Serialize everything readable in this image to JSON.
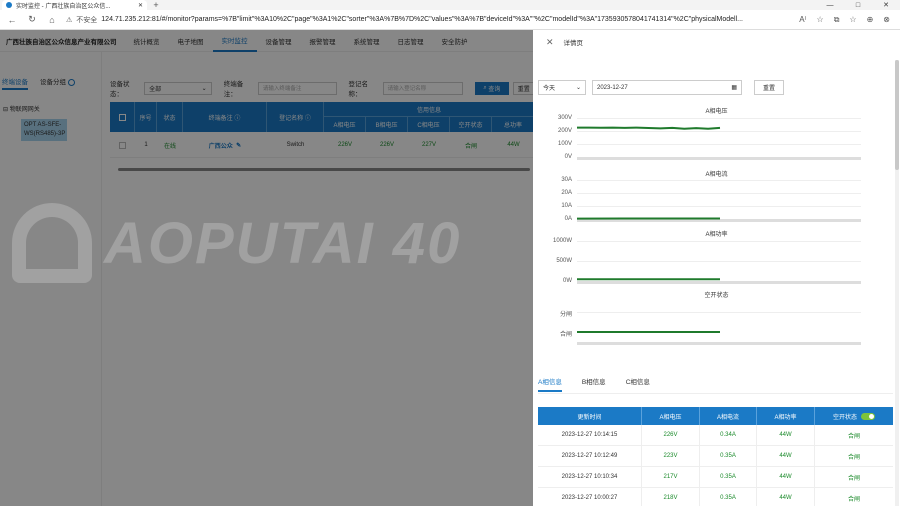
{
  "browser": {
    "tab_title": "实时监控 - 广西壮族自治区公众信...",
    "new_tab": "+",
    "window_controls": [
      "—",
      "□",
      "✕"
    ],
    "insecure_label": "不安全",
    "url": "124.71.235.212:81/#/monitor?params=%7B\"limit\"%3A10%2C\"page\"%3A1%2C\"sorter\"%3A%7B%7D%2C\"values\"%3A%7B\"deviceId\"%3A\"\"%2C\"modelId\"%3A\"1735930578041741314\"%2C\"physicalModell...",
    "tools": [
      "A⁾",
      "☆",
      "⧉",
      "☆",
      "⊕",
      "⊗"
    ]
  },
  "app": {
    "brand": "广西壮族自治区公众信息产业有限公司",
    "nav": [
      "统计概览",
      "电子地图",
      "实时监控",
      "设备管理",
      "报警管理",
      "系统管理",
      "日志管理",
      "安全防护"
    ],
    "nav_active": "实时监控"
  },
  "left_panel": {
    "tabs": [
      "终端设备",
      "设备分组"
    ],
    "tree_root": "物联网网关",
    "tree_child": "OPT AS-SFE-WS(RS485)-3P"
  },
  "filters": {
    "status_label": "设备状态：",
    "status_value": "全部",
    "remark_label": "终端备注：",
    "remark_placeholder": "请输入终端备注",
    "reg_label": "登记名称：",
    "reg_placeholder": "请输入登记名称",
    "query": "查询",
    "reset": "重置"
  },
  "table": {
    "headers": {
      "seq": "序号",
      "status": "状态",
      "remark": "终端备注",
      "reg": "登记名称",
      "group": "信用信息"
    },
    "sub_headers": [
      "A相电压",
      "B相电压",
      "C相电压",
      "空开状态",
      "总功率"
    ],
    "rows": [
      {
        "seq": "1",
        "status": "在线",
        "remark": "广西公众",
        "reg": "Switch",
        "a": "226V",
        "b": "226V",
        "c": "227V",
        "switch": "合闸",
        "power": "44W"
      }
    ]
  },
  "watermark": "AOPUTAI 40",
  "drawer": {
    "title": "详情页",
    "period": "今天",
    "date": "2023-12-27",
    "reset": "重置",
    "charts": [
      {
        "title": "A相电压",
        "yticks": [
          "300V",
          "200V",
          "100V",
          "0V"
        ]
      },
      {
        "title": "A相电流",
        "yticks": [
          "30A",
          "20A",
          "10A",
          "0A"
        ]
      },
      {
        "title": "A相功率",
        "yticks": [
          "1000W",
          "500W",
          "0W"
        ]
      },
      {
        "title": "空开状态",
        "yticks": [
          "分闸",
          "合闸"
        ]
      }
    ],
    "phase_tabs": [
      "A相信息",
      "B相信息",
      "C相信息"
    ],
    "detail_headers": [
      "更新时间",
      "A相电压",
      "A相电流",
      "A相功率",
      "空开状态"
    ],
    "detail_rows": [
      {
        "time": "2023-12-27 10:14:15",
        "v": "226V",
        "i": "0.34A",
        "p": "44W",
        "s": "合闸"
      },
      {
        "time": "2023-12-27 10:12:49",
        "v": "223V",
        "i": "0.35A",
        "p": "44W",
        "s": "合闸"
      },
      {
        "time": "2023-12-27 10:10:34",
        "v": "217V",
        "i": "0.35A",
        "p": "44W",
        "s": "合闸"
      },
      {
        "time": "2023-12-27 10:00:27",
        "v": "218V",
        "i": "0.35A",
        "p": "44W",
        "s": "合闸"
      }
    ]
  },
  "chart_data": [
    {
      "type": "line",
      "title": "A相电压",
      "ylim": [
        0,
        300
      ],
      "series": [
        {
          "values": [
            226,
            226,
            225,
            226,
            224,
            226,
            223,
            220,
            224,
            217,
            222,
            218,
            224
          ]
        }
      ]
    },
    {
      "type": "line",
      "title": "A相电流",
      "ylim": [
        0,
        30
      ],
      "series": [
        {
          "values": [
            0.34,
            0.35,
            0.35,
            0.35
          ]
        }
      ]
    },
    {
      "type": "line",
      "title": "A相功率",
      "ylim": [
        0,
        1000
      ],
      "series": [
        {
          "values": [
            44,
            44,
            44,
            44
          ]
        }
      ]
    },
    {
      "type": "line",
      "title": "空开状态",
      "series": [
        {
          "values": [
            "合闸",
            "合闸",
            "合闸",
            "合闸"
          ]
        }
      ]
    }
  ],
  "colors": {
    "primary": "#1b7ac6",
    "green": "#1a8a2a"
  }
}
